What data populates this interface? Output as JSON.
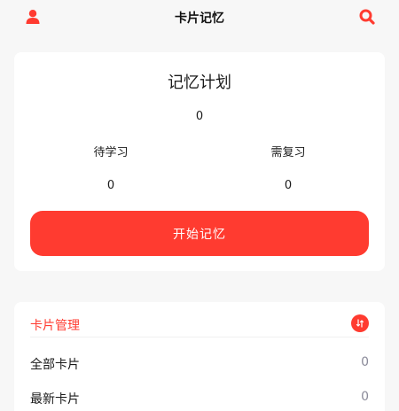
{
  "header": {
    "title": "卡片记忆"
  },
  "plan": {
    "title": "记忆计划",
    "total": "0",
    "pending_label": "待学习",
    "pending_value": "0",
    "review_label": "需复习",
    "review_value": "0",
    "start_label": "开始记忆"
  },
  "manage": {
    "title": "卡片管理",
    "rows": [
      {
        "label": "全部卡片",
        "count": "0"
      },
      {
        "label": "最新卡片",
        "count": "0"
      }
    ]
  },
  "colors": {
    "accent": "#ff3b30",
    "background": "#f7f7f7",
    "card": "#ffffff"
  },
  "icons": {
    "user": "user-icon",
    "search": "search-icon",
    "sort": "sort-icon"
  }
}
